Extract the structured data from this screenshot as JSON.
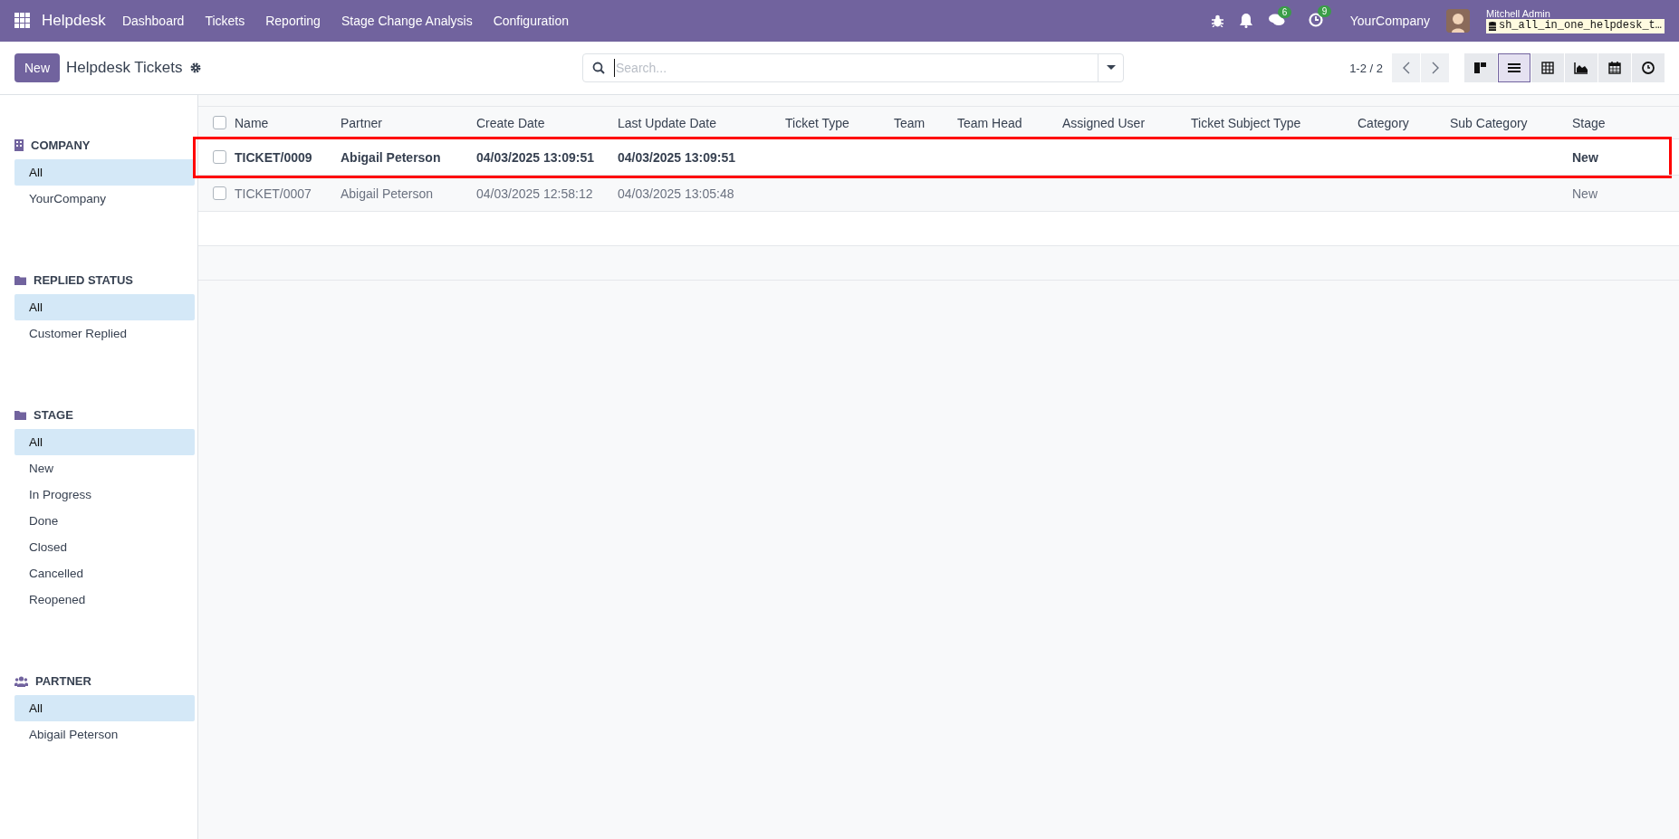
{
  "navbar": {
    "app_name": "Helpdesk",
    "menu": [
      "Dashboard",
      "Tickets",
      "Reporting",
      "Stage Change Analysis",
      "Configuration"
    ],
    "messages_count": "6",
    "activities_count": "9",
    "company": "YourCompany",
    "user_name": "Mitchell Admin",
    "database": "sh_all_in_one_helpdesk_t…"
  },
  "control_panel": {
    "new_button": "New",
    "title": "Helpdesk Tickets",
    "search": {
      "placeholder": "Search..."
    },
    "pager": "1-2 / 2",
    "views": [
      {
        "kind": "kanban",
        "selected": false
      },
      {
        "kind": "list",
        "selected": true
      },
      {
        "kind": "pivot",
        "selected": false
      },
      {
        "kind": "graph",
        "selected": false
      },
      {
        "kind": "calendar",
        "selected": false
      },
      {
        "kind": "activity",
        "selected": false
      }
    ]
  },
  "sidebar": [
    {
      "kind": "building",
      "title": "COMPANY",
      "items": [
        {
          "label": "All",
          "selected": true
        },
        {
          "label": "YourCompany",
          "selected": false
        }
      ]
    },
    {
      "kind": "folder",
      "title": "REPLIED STATUS",
      "items": [
        {
          "label": "All",
          "selected": true
        },
        {
          "label": "Customer Replied",
          "selected": false
        }
      ]
    },
    {
      "kind": "folder",
      "title": "STAGE",
      "items": [
        {
          "label": "All",
          "selected": true
        },
        {
          "label": "New",
          "selected": false
        },
        {
          "label": "In Progress",
          "selected": false
        },
        {
          "label": "Done",
          "selected": false
        },
        {
          "label": "Closed",
          "selected": false
        },
        {
          "label": "Cancelled",
          "selected": false
        },
        {
          "label": "Reopened",
          "selected": false
        }
      ]
    },
    {
      "kind": "users",
      "title": "PARTNER",
      "items": [
        {
          "label": "All",
          "selected": true
        },
        {
          "label": "Abigail Peterson",
          "selected": false
        }
      ]
    }
  ],
  "table": {
    "select_all_checked": false,
    "columns": [
      "Name",
      "Partner",
      "Create Date",
      "Last Update Date",
      "Ticket Type",
      "Team",
      "Team Head",
      "Assigned User",
      "Ticket Subject Type",
      "Category",
      "Sub Category",
      "Stage"
    ],
    "rows": [
      {
        "checked": false,
        "bold": true,
        "highlighted": true,
        "cells": [
          "TICKET/0009",
          "Abigail Peterson",
          "04/03/2025 13:09:51",
          "04/03/2025 13:09:51",
          "",
          "",
          "",
          "",
          "",
          "",
          "",
          "New"
        ]
      },
      {
        "checked": false,
        "bold": false,
        "highlighted": false,
        "cells": [
          "TICKET/0007",
          "Abigail Peterson",
          "04/03/2025 12:58:12",
          "04/03/2025 13:05:48",
          "",
          "",
          "",
          "",
          "",
          "",
          "",
          "New"
        ]
      }
    ]
  }
}
